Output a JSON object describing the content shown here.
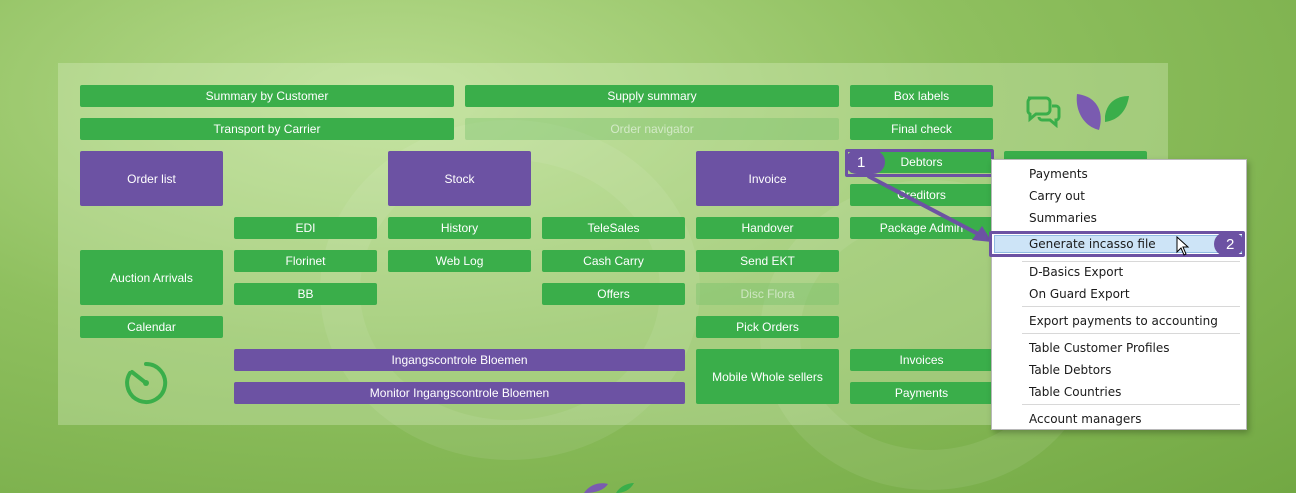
{
  "buttons": {
    "summary_by_customer": "Summary by Customer",
    "supply_summary": "Supply summary",
    "box_labels": "Box labels",
    "transport_by_carrier": "Transport by Carrier",
    "order_navigator": "Order navigator",
    "final_check": "Final check",
    "order_list": "Order list",
    "stock": "Stock",
    "invoice": "Invoice",
    "debtors": "Debtors",
    "creditors": "Creditors",
    "edi": "EDI",
    "history": "History",
    "telesales": "TeleSales",
    "handover": "Handover",
    "package_admin": "Package Admin",
    "auction_arrivals": "Auction Arrivals",
    "florinet": "Florinet",
    "web_log": "Web Log",
    "cash_carry": "Cash Carry",
    "send_ekt": "Send EKT",
    "bb": "BB",
    "offers": "Offers",
    "disc_flora": "Disc Flora",
    "calendar": "Calendar",
    "pick_orders": "Pick Orders",
    "ingangscontrole_bloemen": "Ingangscontrole Bloemen",
    "monitor_ingangscontrole_bloemen": "Monitor Ingangscontrole Bloemen",
    "mobile_whole_sellers": "Mobile Whole sellers",
    "invoices": "Invoices",
    "payments": "Payments"
  },
  "context_menu": {
    "items": [
      "Payments",
      "Carry out",
      "Summaries",
      "Generate incasso file",
      "D-Basics Export",
      "On Guard Export",
      "Export payments to accounting",
      "Table Customer Profiles",
      "Table Debtors",
      "Table Countries",
      "Account managers"
    ],
    "highlighted_index": 3
  },
  "callouts": {
    "step1": "1",
    "step2": "2"
  },
  "colors": {
    "green": "#3aae4a",
    "purple": "#6c52a3",
    "highlight": "#cde4f7"
  }
}
